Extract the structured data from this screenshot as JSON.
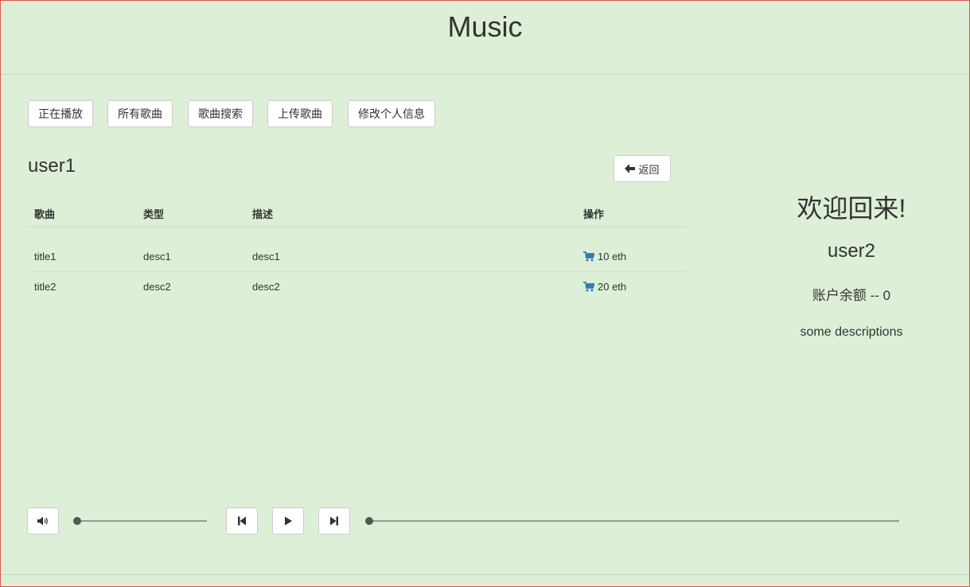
{
  "header": {
    "title": "Music"
  },
  "nav": [
    {
      "label": "正在播放"
    },
    {
      "label": "所有歌曲"
    },
    {
      "label": "歌曲搜索"
    },
    {
      "label": "上传歌曲"
    },
    {
      "label": "修改个人信息"
    }
  ],
  "main": {
    "user_title": "user1",
    "back_label": "返回",
    "table": {
      "headers": [
        "歌曲",
        "类型",
        "描述",
        "操作"
      ],
      "rows": [
        {
          "title": "title1",
          "type": "desc1",
          "desc": "desc1",
          "price": "10 eth"
        },
        {
          "title": "title2",
          "type": "desc2",
          "desc": "desc2",
          "price": "20 eth"
        }
      ]
    }
  },
  "sidebar": {
    "welcome": "欢迎回来!",
    "username": "user2",
    "balance": "账户余额 -- 0",
    "description": "some descriptions"
  },
  "player": {
    "volume": 0,
    "progress": 0
  },
  "colors": {
    "background": "#deefd8",
    "accent": "#337ab7"
  }
}
